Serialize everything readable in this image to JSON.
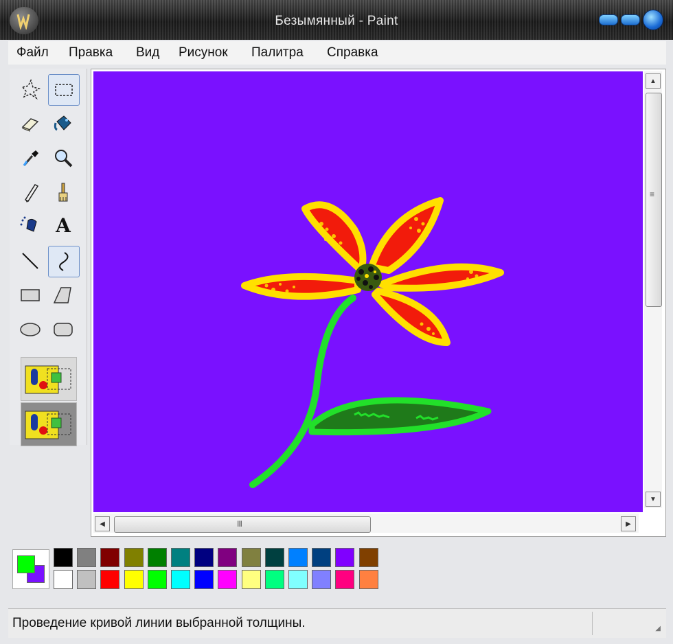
{
  "window": {
    "title": "Безымянный - Paint",
    "title_color": "#e8e8e8"
  },
  "menu": [
    "Файл",
    "Правка",
    "Вид",
    "Рисунок",
    "Палитра",
    "Справка"
  ],
  "tools": [
    {
      "name": "free-form-select",
      "icon": "star-select-icon",
      "selected": false
    },
    {
      "name": "rect-select",
      "icon": "rect-select-icon",
      "selected": true
    },
    {
      "name": "eraser",
      "icon": "eraser-icon",
      "selected": false
    },
    {
      "name": "fill",
      "icon": "paint-bucket-icon",
      "selected": false
    },
    {
      "name": "color-picker",
      "icon": "eyedropper-icon",
      "selected": false
    },
    {
      "name": "magnifier",
      "icon": "magnifier-icon",
      "selected": false
    },
    {
      "name": "pencil",
      "icon": "pencil-icon",
      "selected": false
    },
    {
      "name": "brush",
      "icon": "brush-icon",
      "selected": false
    },
    {
      "name": "airbrush",
      "icon": "airbrush-icon",
      "selected": false
    },
    {
      "name": "text",
      "icon": "text-icon",
      "label": "A",
      "selected": false
    },
    {
      "name": "line",
      "icon": "line-icon",
      "selected": false
    },
    {
      "name": "curve",
      "icon": "curve-icon",
      "selected": true
    },
    {
      "name": "rectangle",
      "icon": "rectangle-icon",
      "selected": false
    },
    {
      "name": "polygon",
      "icon": "polygon-icon",
      "selected": false
    },
    {
      "name": "ellipse",
      "icon": "ellipse-icon",
      "selected": false
    },
    {
      "name": "rounded-rectangle",
      "icon": "rounded-rect-icon",
      "selected": false
    }
  ],
  "canvas": {
    "background_color": "#7a11ff"
  },
  "scrollbars": {
    "horizontal_grip": "III",
    "vertical_grip": "≡"
  },
  "colors": {
    "foreground": "#00ff00",
    "background": "#7a11ff"
  },
  "palette": {
    "row1": [
      "#000000",
      "#808080",
      "#800000",
      "#808000",
      "#008000",
      "#008080",
      "#000080",
      "#800080",
      "#808040",
      "#004040",
      "#0080ff",
      "#004080",
      "#8000ff",
      "#804000"
    ],
    "row2": [
      "#ffffff",
      "#c0c0c0",
      "#ff0000",
      "#ffff00",
      "#00ff00",
      "#00ffff",
      "#0000ff",
      "#ff00ff",
      "#ffff80",
      "#00ff80",
      "#80ffff",
      "#8080ff",
      "#ff0080",
      "#ff8040"
    ]
  },
  "status": {
    "text": "Проведение кривой линии выбранной толщины."
  }
}
